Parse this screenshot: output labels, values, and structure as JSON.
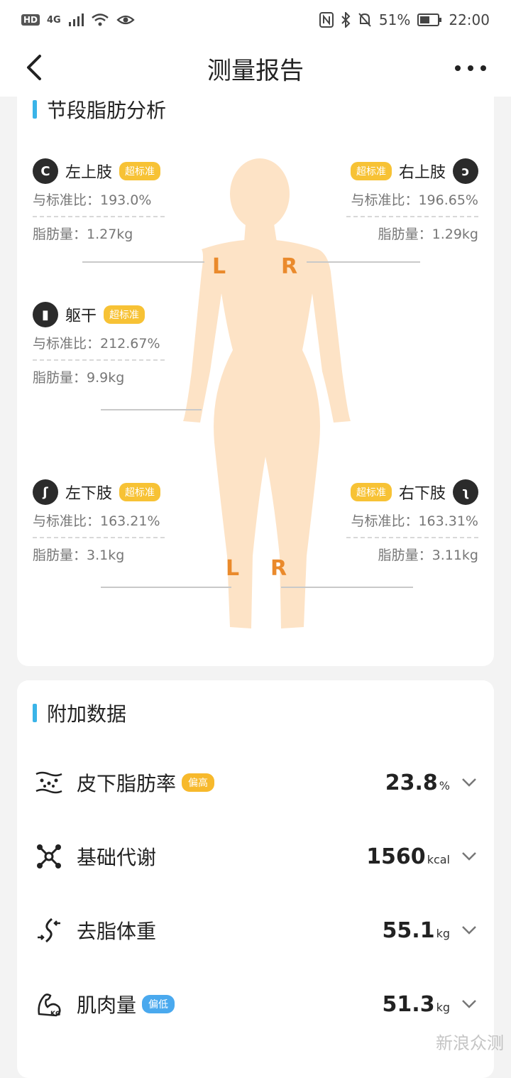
{
  "status_bar": {
    "hd": "HD",
    "network": "4G",
    "battery": "51%",
    "time": "22:00"
  },
  "header": {
    "title": "测量报告"
  },
  "segment_section": {
    "title": "节段脂肪分析",
    "left_arm": {
      "name": "左上肢",
      "badge": "超标准",
      "ratio": "与标准比：193.0%",
      "fat": "脂肪量：1.27kg"
    },
    "right_arm": {
      "name": "右上肢",
      "badge": "超标准",
      "ratio": "与标准比：196.65%",
      "fat": "脂肪量：1.29kg"
    },
    "trunk": {
      "name": "躯干",
      "badge": "超标准",
      "ratio": "与标准比：212.67%",
      "fat": "脂肪量：9.9kg"
    },
    "left_leg": {
      "name": "左下肢",
      "badge": "超标准",
      "ratio": "与标准比：163.21%",
      "fat": "脂肪量：3.1kg"
    },
    "right_leg": {
      "name": "右下肢",
      "badge": "超标准",
      "ratio": "与标准比：163.31%",
      "fat": "脂肪量：3.11kg"
    },
    "markers": {
      "upper_left": "L",
      "upper_right": "R",
      "lower_left": "L",
      "lower_right": "R"
    }
  },
  "extra_section": {
    "title": "附加数据",
    "items": [
      {
        "name": "皮下脂肪率",
        "tag": "偏高",
        "tag_color": "#f7b92c",
        "value": "23.8",
        "unit": "%"
      },
      {
        "name": "基础代谢",
        "tag": "",
        "value": "1560",
        "unit": "kcal"
      },
      {
        "name": "去脂体重",
        "tag": "",
        "value": "55.1",
        "unit": "kg"
      },
      {
        "name": "肌肉量",
        "tag": "偏低",
        "tag_color": "#4aa9ee",
        "value": "51.3",
        "unit": "kg"
      }
    ]
  },
  "colors": {
    "accent_bar": "#3ab4e8",
    "badge_over": "#f7c235",
    "body_fill": "#fde3c6",
    "marker": "#ea8a2c"
  },
  "watermark": "新浪众测"
}
